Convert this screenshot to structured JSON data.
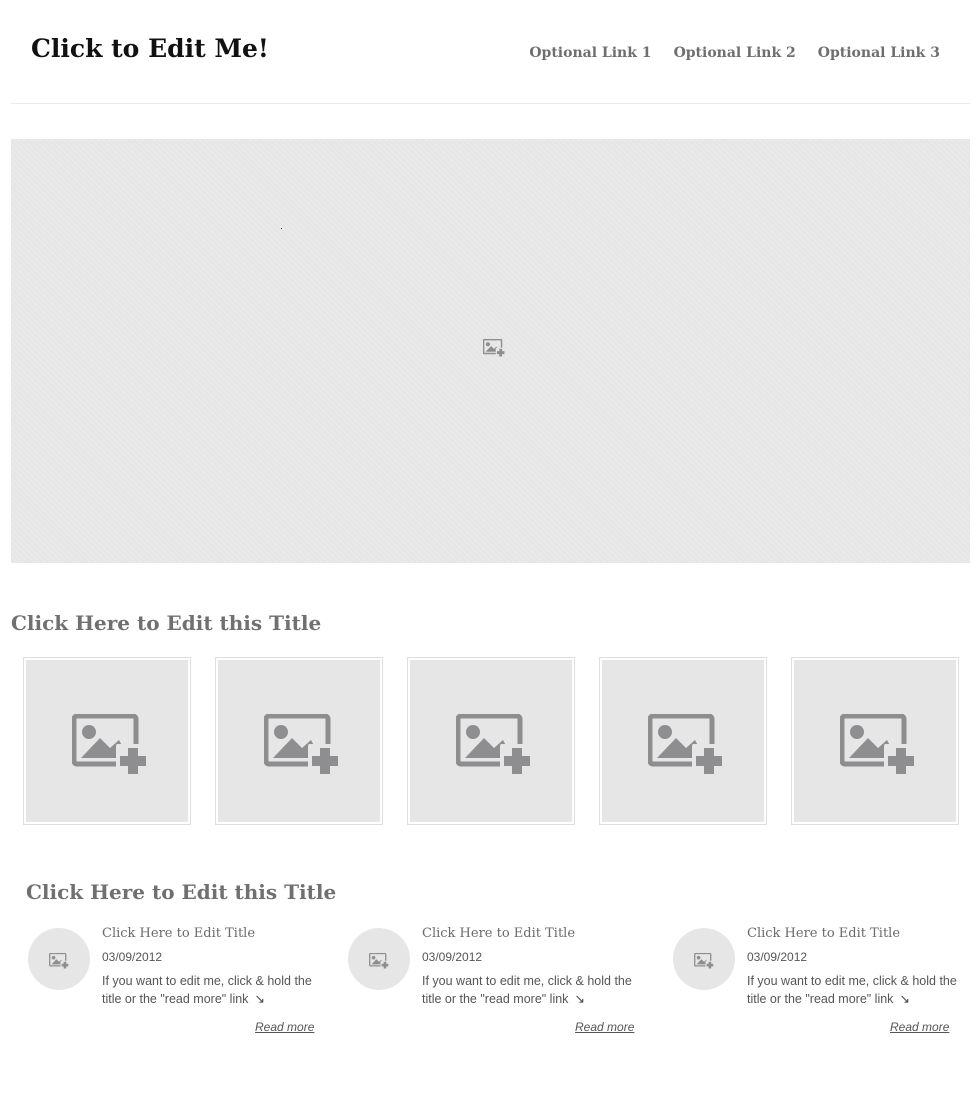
{
  "header": {
    "site_title": "Click to Edit Me!",
    "nav": [
      "Optional Link 1",
      "Optional Link 2",
      "Optional Link 3"
    ]
  },
  "hero": {
    "icon": "add-image-icon"
  },
  "gallery": {
    "title": "Click Here to Edit this Title",
    "icon": "add-image-icon",
    "thumbnail_count": 5
  },
  "blog": {
    "title": "Click Here to Edit this Title",
    "posts": [
      {
        "title": "Click Here to Edit Title",
        "date": "03/09/2012",
        "excerpt": "If you want to edit me, click & hold the title or the \"read more\" link",
        "arrow": "↘",
        "read_more": "Read more"
      },
      {
        "title": "Click Here to Edit Title",
        "date": "03/09/2012",
        "excerpt": "If you want to edit me, click & hold the title or the \"read more\" link",
        "arrow": "↘",
        "read_more": "Read more"
      },
      {
        "title": "Click Here to Edit Title",
        "date": "03/09/2012",
        "excerpt": "If you want to edit me, click & hold the title or the \"read more\" link",
        "arrow": "↘",
        "read_more": "Read more"
      }
    ]
  },
  "colors": {
    "placeholder_bg": "#e6e6e7",
    "icon_gray": "#8e8e90",
    "title_text": "#111111",
    "section_title": "#707070"
  }
}
